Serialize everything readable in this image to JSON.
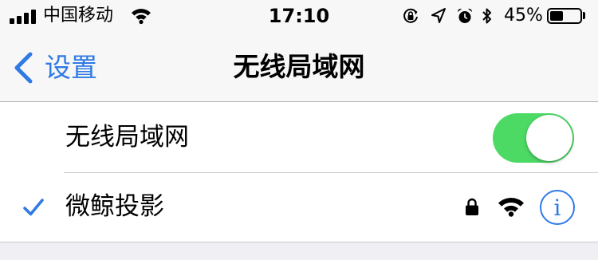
{
  "status_bar": {
    "carrier": "中国移动",
    "time": "17:10",
    "battery_percent_label": "45%",
    "battery_level": 0.45,
    "signal_bars": 4,
    "icons": [
      "signal-icon",
      "wifi-icon",
      "orientation-lock-icon",
      "location-arrow-icon",
      "alarm-icon",
      "bluetooth-icon",
      "battery-icon"
    ]
  },
  "nav": {
    "back_label": "设置",
    "title": "无线局域网"
  },
  "wifi_toggle": {
    "label": "无线局域网",
    "on": true,
    "on_color": "#4cd964"
  },
  "network": {
    "name": "微鲸投影",
    "connected": true,
    "secured": true,
    "info_label": "i"
  },
  "colors": {
    "accent": "#2f7ae5",
    "background": "#efeff4"
  }
}
